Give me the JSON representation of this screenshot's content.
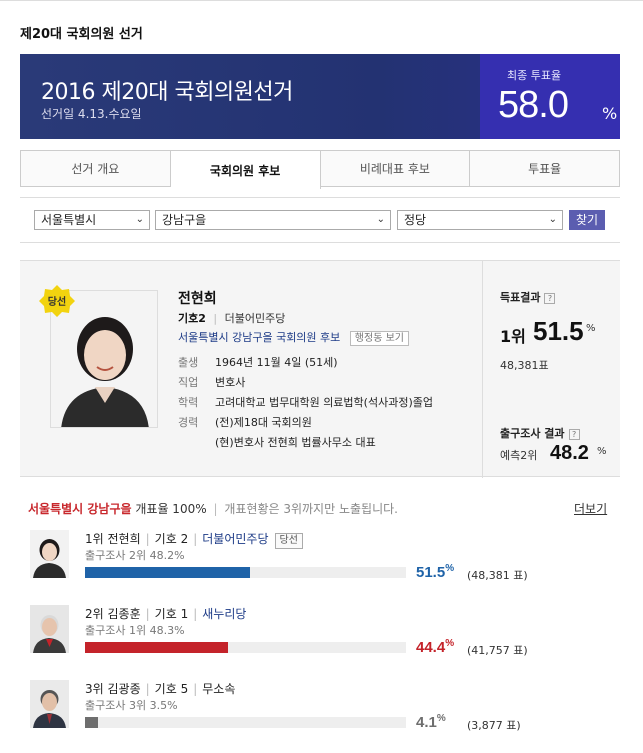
{
  "page_title": "제20대 국회의원 선거",
  "banner": {
    "title": "2016 제20대 국회의원선거",
    "date": "선거일  4.13.수요일",
    "turnout_label": "최종 투표율",
    "turnout_value": "58.0",
    "turnout_unit": "%"
  },
  "tabs": [
    {
      "label": "선거 개요"
    },
    {
      "label": "국회의원 후보"
    },
    {
      "label": "비례대표 후보"
    },
    {
      "label": "투표율"
    }
  ],
  "filters": {
    "region": "서울특별시",
    "district": "강남구을",
    "party": "정당",
    "find_label": "찾기"
  },
  "candidate": {
    "badge": "당선",
    "name": "전현희",
    "number_label": "기호2",
    "party": "더불어민주당",
    "district_text": "서울특별시 강남구을 국회의원 후보",
    "admin_btn": "행정동 보기",
    "info": [
      {
        "label": "출생",
        "value": "1964년 11월 4일 (51세)"
      },
      {
        "label": "직업",
        "value": "변호사"
      },
      {
        "label": "학력",
        "value": "고려대학교 법무대학원 의료법학(석사과정)졸업"
      },
      {
        "label": "경력",
        "value": "(전)제18대 국회의원"
      },
      {
        "label": "",
        "value": "(현)변호사 전현희 법률사무소 대표"
      }
    ],
    "result_label": "득표결과",
    "result_rank": "1위",
    "result_pct": "51.5",
    "result_pct_unit": "%",
    "result_votes": "48,381표",
    "exit_label": "출구조사 결과",
    "exit_text": "예측2위",
    "exit_pct": "48.2",
    "exit_unit": "%"
  },
  "results_header": {
    "region": "서울특별시 강남구을",
    "count_text": "개표율 100%",
    "note": "개표현황은 3위까지만 노출됩니다.",
    "more": "더보기"
  },
  "results": [
    {
      "rank_name": "1위 전현희",
      "number": "기호 2",
      "party": "더불어민주당",
      "won": "당선",
      "exit": "출구조사 2위 48.2%",
      "pct": "51.5",
      "votes": "(48,381 표)",
      "share": 51.5,
      "color": "#1f63a8"
    },
    {
      "rank_name": "2위 김종훈",
      "number": "기호 1",
      "party": "새누리당",
      "won": "",
      "exit": "출구조사 1위 48.3%",
      "pct": "44.4",
      "votes": "(41,757 표)",
      "share": 44.4,
      "color": "#c4232a"
    },
    {
      "rank_name": "3위 김광종",
      "number": "기호 5",
      "party": "무소속",
      "won": "",
      "exit": "출구조사 3위 3.5%",
      "pct": "4.1",
      "votes": "(3,877 표)",
      "share": 4.1,
      "color": "#6e6e6e"
    }
  ]
}
